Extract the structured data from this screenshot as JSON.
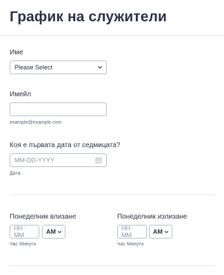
{
  "form": {
    "title": "График на служители",
    "name": {
      "label": "Име",
      "select_value": "Please Select"
    },
    "email": {
      "label": "Имейл",
      "value": "",
      "hint": "example@example.com"
    },
    "first_day": {
      "label": "Коя е първата дата от седмицата?",
      "placeholder": "MM-DD-YYYY",
      "sublabel": "Дата"
    },
    "monday_in": {
      "label": "Понеделник влизане",
      "placeholder": "HH : MM",
      "ampm": "AM",
      "sublabel": "Час Минути"
    },
    "monday_out": {
      "label": "Понеделник излизане",
      "placeholder": "HH : MM",
      "ampm": "AM",
      "sublabel": "Час Минути"
    }
  },
  "icons": {
    "select_chevron": "chevron-down-icon",
    "calendar": "calendar-icon",
    "ampm_chevron": "chevron-down-icon"
  },
  "colors": {
    "text": "#2b3245",
    "border": "#b8bdc9",
    "muted": "#57647e",
    "divider": "#e4e6ee"
  }
}
